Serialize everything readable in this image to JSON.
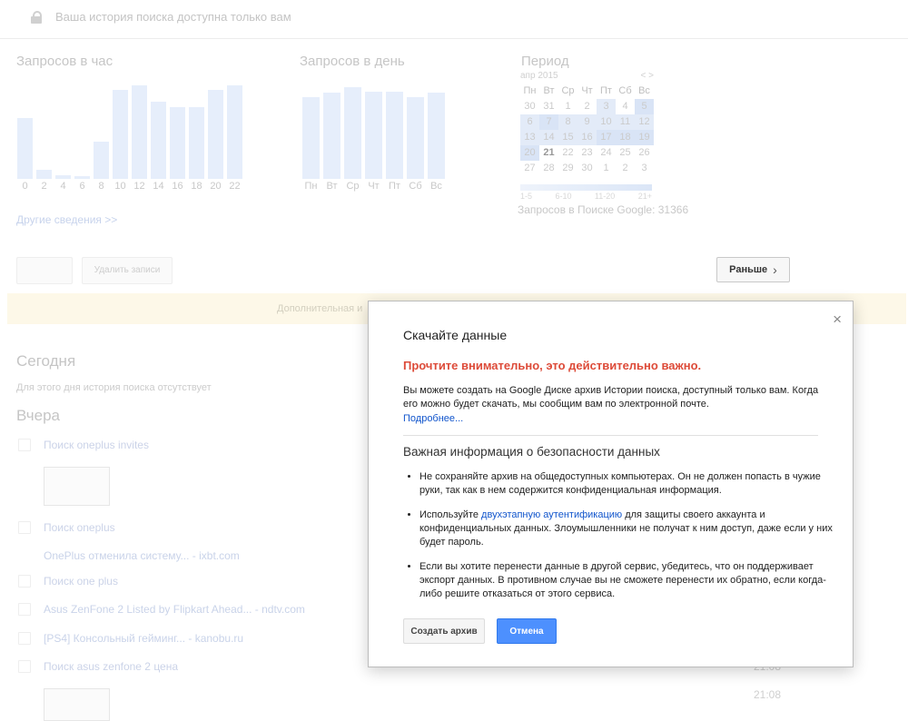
{
  "top": {
    "privacy_text": "Ваша история поиска доступна только вам"
  },
  "hourly": {
    "title": "Запросов в час",
    "ticks": [
      "0",
      "2",
      "4",
      "6",
      "8",
      "10",
      "12",
      "14",
      "16",
      "18",
      "20",
      "22"
    ]
  },
  "daily": {
    "title": "Запросов в день",
    "ticks": [
      "Пн",
      "Вт",
      "Ср",
      "Чт",
      "Пт",
      "Сб",
      "Вс"
    ]
  },
  "period": {
    "title": "Период",
    "month": "апр 2015",
    "nav": "< >",
    "weekdays": [
      "Пн",
      "Вт",
      "Ср",
      "Чт",
      "Пт",
      "Сб",
      "Вс"
    ],
    "rows": [
      [
        "30",
        "31",
        "1",
        "2",
        "3",
        "4",
        "5"
      ],
      [
        "6",
        "7",
        "8",
        "9",
        "10",
        "11",
        "12"
      ],
      [
        "13",
        "14",
        "15",
        "16",
        "17",
        "18",
        "19"
      ],
      [
        "20",
        "21",
        "22",
        "23",
        "24",
        "25",
        "26"
      ],
      [
        "27",
        "28",
        "29",
        "30",
        "1",
        "2",
        "3"
      ]
    ],
    "legend": [
      "1-5",
      "6-10",
      "11-20",
      "21+"
    ]
  },
  "queries_total": "Запросов в Поиске Google: 31366",
  "more_link": "Другие сведения >>",
  "toolbar": {
    "delete_label": "Удалить записи",
    "earlier_label": "Раньше"
  },
  "notice": "Дополнительная и",
  "history": {
    "today_label": "Сегодня",
    "today_empty": "Для этого дня история поиска отсутствует",
    "yesterday_label": "Вчера",
    "items": [
      "Поиск oneplus invites",
      "Поиск oneplus",
      "OnePlus отменила систему... - ixbt.com",
      "Поиск one plus",
      "Asus ZenFone 2 Listed by Flipkart Ahead... - ndtv.com",
      "[PS4] Консольный гейминг... - kanobu.ru",
      "Поиск asus zenfone 2 цена"
    ],
    "times": [
      "21:08",
      "21:08"
    ]
  },
  "dialog": {
    "title": "Скачайте данные",
    "warning": "Прочтите внимательно, это действительно важно.",
    "paragraph": "Вы можете создать на Google Диске архив Истории поиска, доступный только вам. Когда его можно будет скачать, мы сообщим вам по электронной почте.",
    "more_link": "Подробнее...",
    "subtitle": "Важная информация о безопасности данных",
    "bullet1": "Не сохраняйте архив на общедоступных компьютерах. Он не должен попасть в чужие руки, так как в нем содержится конфиденциальная информация.",
    "bullet2_pre": "Используйте ",
    "bullet2_link": "двухэтапную аутентификацию",
    "bullet2_post": " для защиты своего аккаунта и конфиденциальных данных. Злоумышленники не получат к ним доступ, даже если у них будет пароль.",
    "bullet3": "Если вы хотите перенести данные в другой сервис, убедитесь, что он поддерживает экспорт данных. В противном случае вы не сможете перенести их обратно, если когда-либо решите отказаться от этого сервиса.",
    "create_label": "Создать архив",
    "cancel_label": "Отмена",
    "close_glyph": "×"
  },
  "colors": {
    "accent_blue": "#4d90fe",
    "warning_red": "#dd4b39",
    "link_blue": "#1155cc"
  }
}
